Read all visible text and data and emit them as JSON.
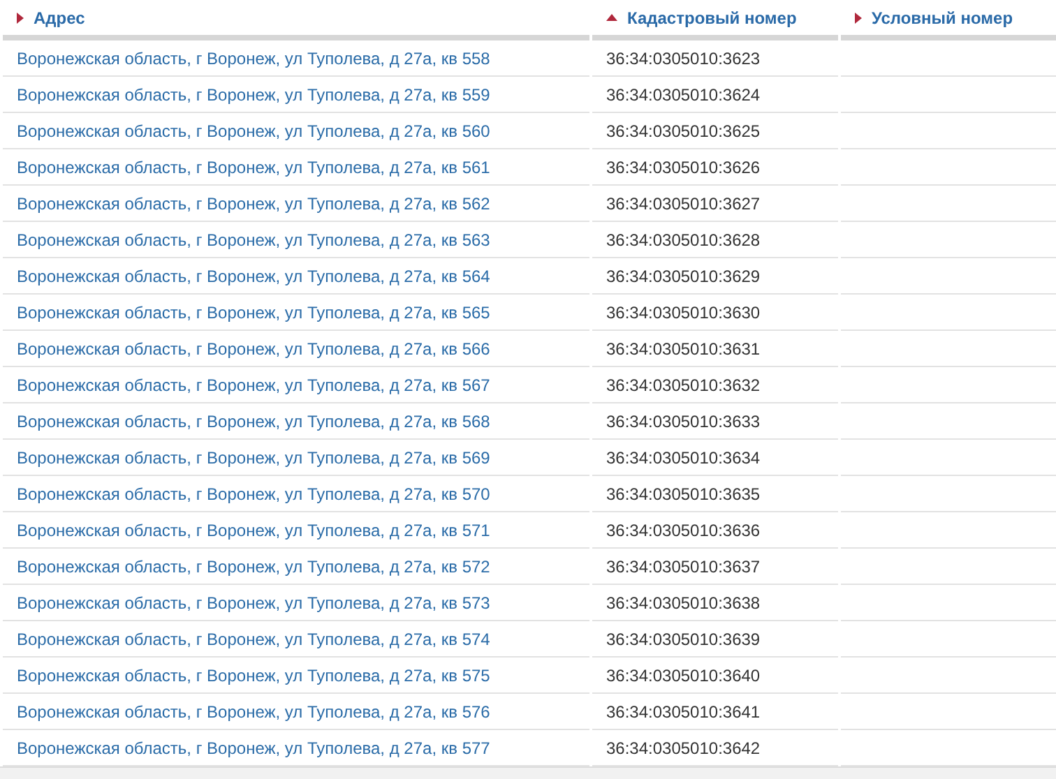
{
  "table": {
    "columns": [
      {
        "label": "Адрес",
        "sorted": false
      },
      {
        "label": "Кадастровый номер",
        "sorted": true
      },
      {
        "label": "Условный номер",
        "sorted": false
      }
    ],
    "rows": [
      {
        "address": "Воронежская область, г Воронеж, ул Туполева, д 27а, кв 558",
        "cadastral": "36:34:0305010:3623"
      },
      {
        "address": "Воронежская область, г Воронеж, ул Туполева, д 27а, кв 559",
        "cadastral": "36:34:0305010:3624"
      },
      {
        "address": "Воронежская область, г Воронеж, ул Туполева, д 27а, кв 560",
        "cadastral": "36:34:0305010:3625"
      },
      {
        "address": "Воронежская область, г Воронеж, ул Туполева, д 27а, кв 561",
        "cadastral": "36:34:0305010:3626"
      },
      {
        "address": "Воронежская область, г Воронеж, ул Туполева, д 27а, кв 562",
        "cadastral": "36:34:0305010:3627"
      },
      {
        "address": "Воронежская область, г Воронеж, ул Туполева, д 27а, кв 563",
        "cadastral": "36:34:0305010:3628"
      },
      {
        "address": "Воронежская область, г Воронеж, ул Туполева, д 27а, кв 564",
        "cadastral": "36:34:0305010:3629"
      },
      {
        "address": "Воронежская область, г Воронеж, ул Туполева, д 27а, кв 565",
        "cadastral": "36:34:0305010:3630"
      },
      {
        "address": "Воронежская область, г Воронеж, ул Туполева, д 27а, кв 566",
        "cadastral": "36:34:0305010:3631"
      },
      {
        "address": "Воронежская область, г Воронеж, ул Туполева, д 27а, кв 567",
        "cadastral": "36:34:0305010:3632"
      },
      {
        "address": "Воронежская область, г Воронеж, ул Туполева, д 27а, кв 568",
        "cadastral": "36:34:0305010:3633"
      },
      {
        "address": "Воронежская область, г Воронеж, ул Туполева, д 27а, кв 569",
        "cadastral": "36:34:0305010:3634"
      },
      {
        "address": "Воронежская область, г Воронеж, ул Туполева, д 27а, кв 570",
        "cadastral": "36:34:0305010:3635"
      },
      {
        "address": "Воронежская область, г Воронеж, ул Туполева, д 27а, кв 571",
        "cadastral": "36:34:0305010:3636"
      },
      {
        "address": "Воронежская область, г Воронеж, ул Туполева, д 27а, кв 572",
        "cadastral": "36:34:0305010:3637"
      },
      {
        "address": "Воронежская область, г Воронеж, ул Туполева, д 27а, кв 573",
        "cadastral": "36:34:0305010:3638"
      },
      {
        "address": "Воронежская область, г Воронеж, ул Туполева, д 27а, кв 574",
        "cadastral": "36:34:0305010:3639"
      },
      {
        "address": "Воронежская область, г Воронеж, ул Туполева, д 27а, кв 575",
        "cadastral": "36:34:0305010:3640"
      },
      {
        "address": "Воронежская область, г Воронеж, ул Туполева, д 27а, кв 576",
        "cadastral": "36:34:0305010:3641"
      },
      {
        "address": "Воронежская область, г Воронеж, ул Туполева, д 27а, кв 577",
        "cadastral": "36:34:0305010:3642"
      }
    ]
  }
}
